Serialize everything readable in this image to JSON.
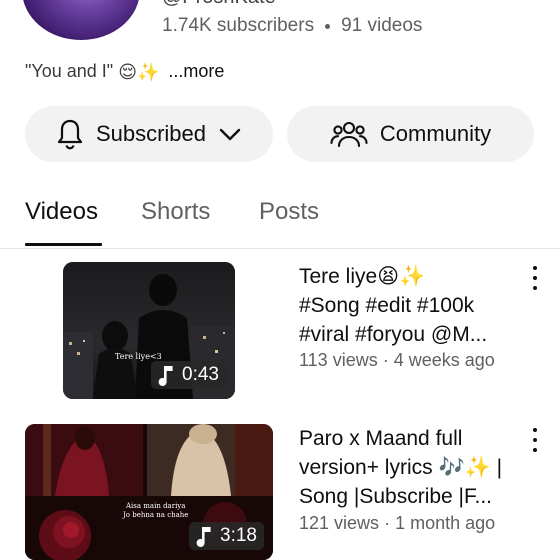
{
  "channel": {
    "handle": "@ProshKate",
    "subscribers": "1.74K subscribers",
    "videos": "91 videos",
    "description": "\"You and I\"",
    "description_emojis": "😌✨",
    "more_label": "...more"
  },
  "actions": {
    "subscribed_label": "Subscribed",
    "community_label": "Community"
  },
  "tabs": [
    {
      "label": "Videos",
      "active": true
    },
    {
      "label": "Shorts",
      "active": false
    },
    {
      "label": "Posts",
      "active": false
    }
  ],
  "videos": [
    {
      "title_line1": "Tere liye😫✨",
      "title_line2": "#Song #edit #100k",
      "title_line3": "#viral #foryou @M...",
      "views": "113 views",
      "age": "4 weeks ago",
      "duration": "0:43",
      "thumb_caption": "Tere liye<3"
    },
    {
      "title_line1": "Paro x Maand full",
      "title_line2": "version+ lyrics 🎶✨ |",
      "title_line3": "Song |Subscribe |F...",
      "views": "121 views",
      "age": "1 month ago",
      "duration": "3:18",
      "thumb_caption_line1": "Aisa main dariya",
      "thumb_caption_line2": "Jo behna na chahe"
    }
  ],
  "colors": {
    "text_primary": "#0f0f0f",
    "text_secondary": "#606060",
    "pill_bg": "#f2f2f2",
    "divider": "#e5e5e5"
  }
}
